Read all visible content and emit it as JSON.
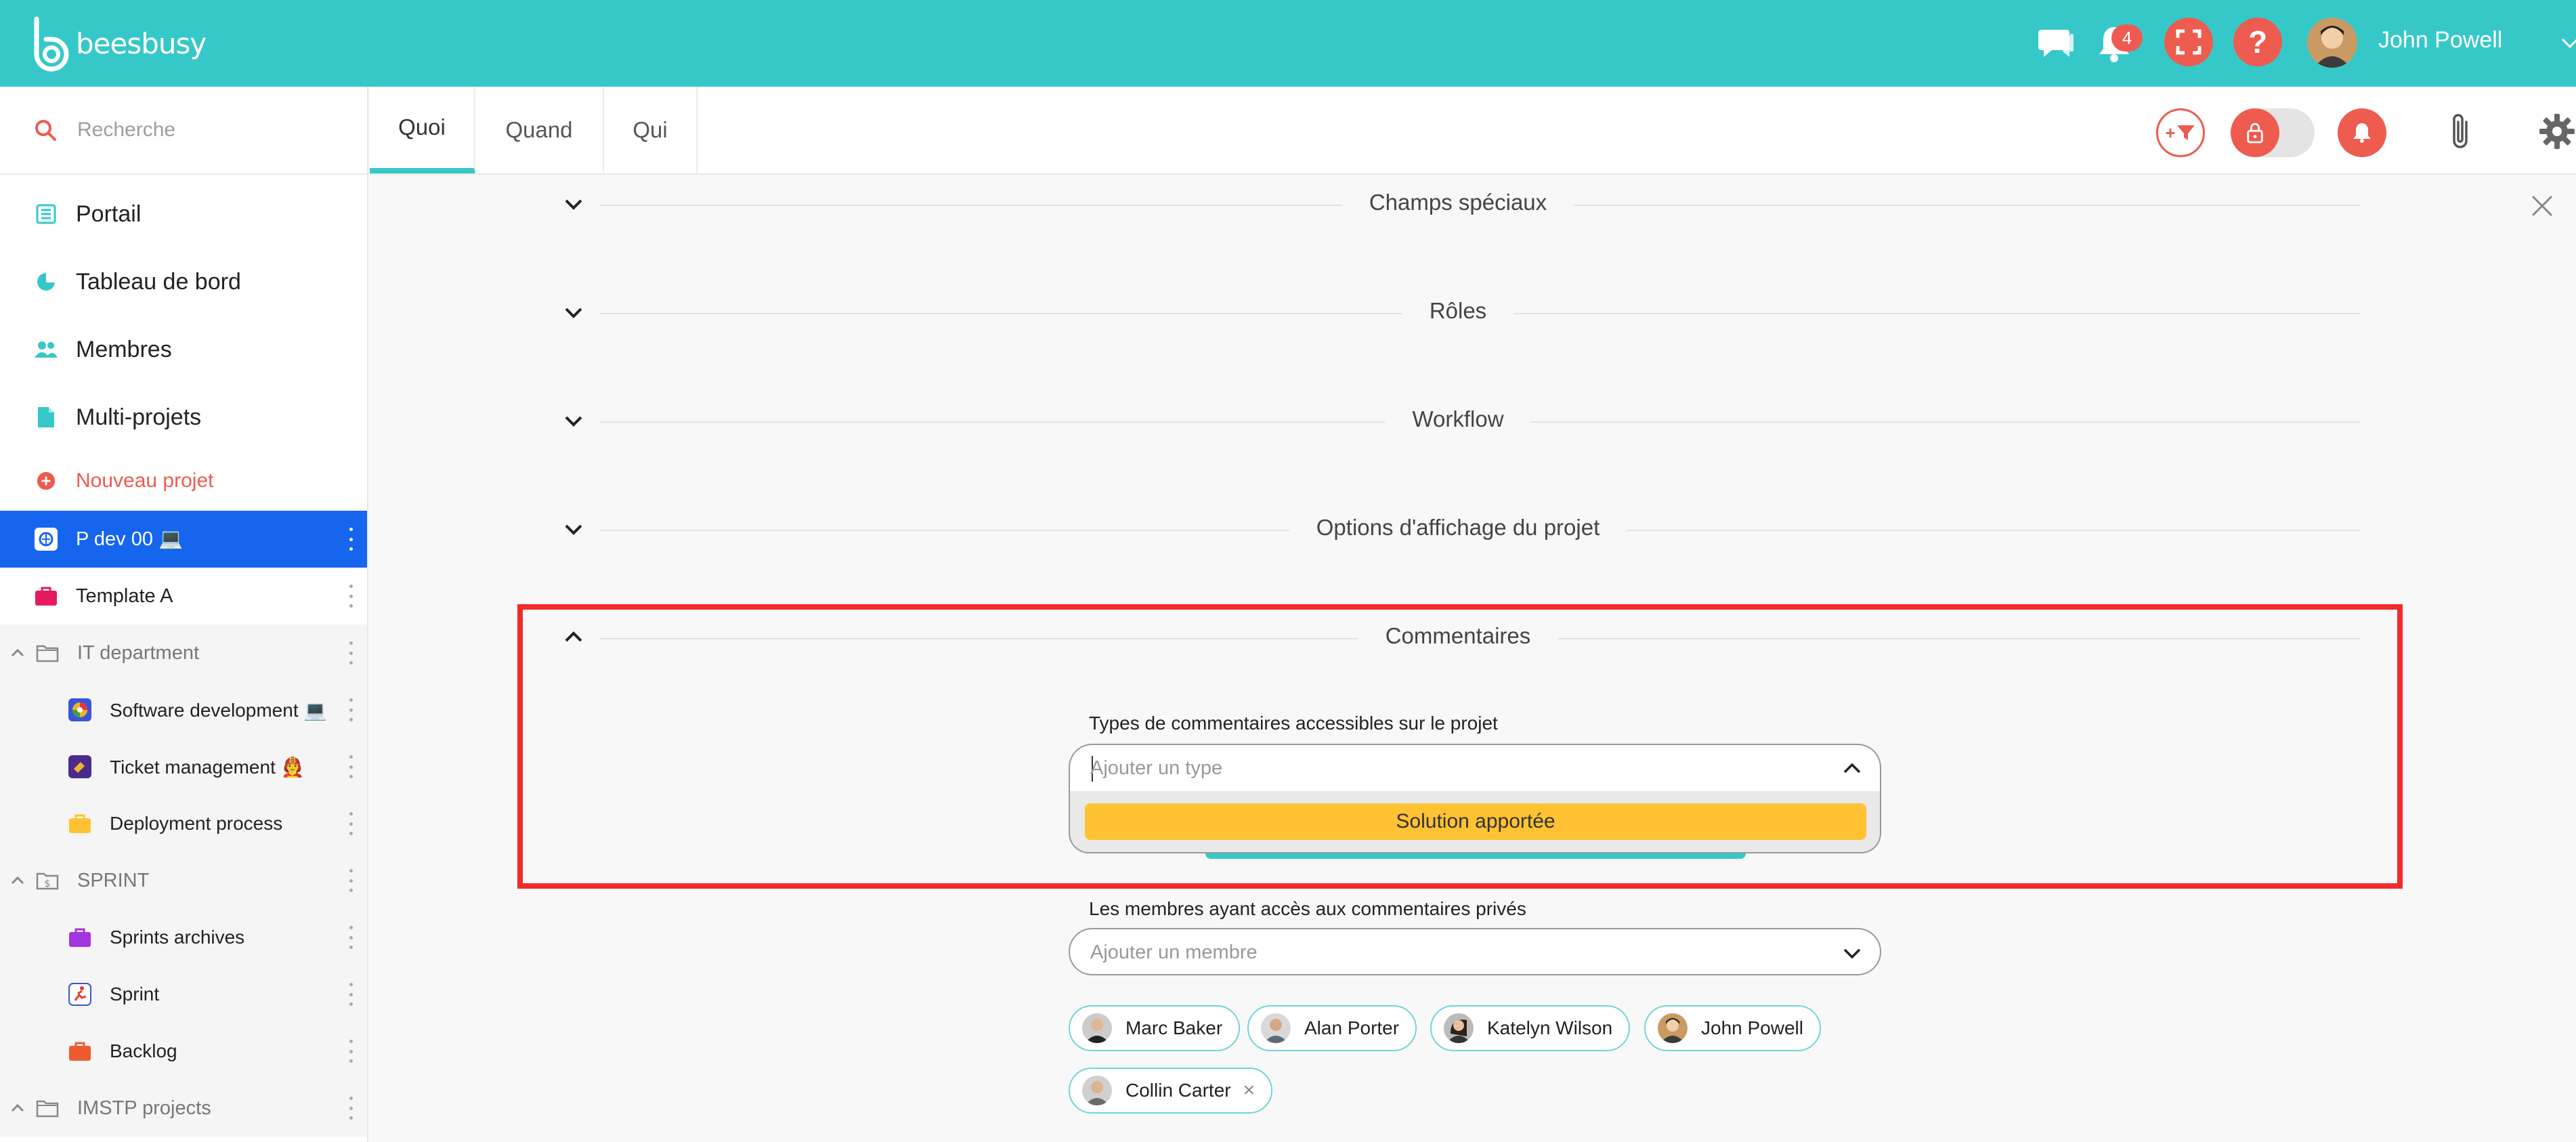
{
  "brand": {
    "logo_text": "beesbusy"
  },
  "topbar": {
    "notifications_count": "4",
    "help_label": "?",
    "user_name": "John Powell"
  },
  "sidebar": {
    "search_placeholder": "Recherche",
    "main_items": [
      {
        "label": "Portail",
        "icon": "list-icon"
      },
      {
        "label": "Tableau de bord",
        "icon": "pie-chart-icon"
      },
      {
        "label": "Membres",
        "icon": "people-icon"
      },
      {
        "label": "Multi-projets",
        "icon": "document-icon"
      }
    ],
    "new_project_label": "Nouveau projet",
    "projects": [
      {
        "label": "P dev 00 💻",
        "active": true
      },
      {
        "label": "Template A",
        "active": false
      }
    ],
    "folders": [
      {
        "label": "IT department",
        "items": [
          {
            "label": "Software development 💻"
          },
          {
            "label": "Ticket management 🧑‍🚒"
          },
          {
            "label": "Deployment process"
          }
        ]
      },
      {
        "label": "SPRINT",
        "items": [
          {
            "label": "Sprints archives"
          },
          {
            "label": "Sprint"
          },
          {
            "label": "Backlog"
          }
        ]
      },
      {
        "label": "IMSTP projects",
        "items": []
      }
    ]
  },
  "tabs": [
    {
      "label": "Quoi",
      "active": true
    },
    {
      "label": "Quand",
      "active": false
    },
    {
      "label": "Qui",
      "active": false
    }
  ],
  "toolbar": {
    "filter_label": "+"
  },
  "sections": [
    {
      "title": "Champs spéciaux",
      "expanded": false
    },
    {
      "title": "Rôles",
      "expanded": false
    },
    {
      "title": "Workflow",
      "expanded": false
    },
    {
      "title": "Options d'affichage du projet",
      "expanded": false
    },
    {
      "title": "Commentaires",
      "expanded": true
    }
  ],
  "comments": {
    "types_label": "Types de commentaires accessibles sur le projet",
    "types_placeholder": "Ajouter un type",
    "types_options": [
      "Solution apportée"
    ],
    "members_label": "Les membres ayant accès aux commentaires privés",
    "members_placeholder": "Ajouter un membre",
    "members": [
      {
        "name": "Marc Baker",
        "removable": false
      },
      {
        "name": "Alan Porter",
        "removable": false
      },
      {
        "name": "Katelyn Wilson",
        "removable": false
      },
      {
        "name": "John Powell",
        "removable": false
      },
      {
        "name": "Collin Carter",
        "removable": true,
        "remove_label": "×"
      }
    ]
  },
  "colors": {
    "brand": "#36c8c9",
    "accent_red": "#ee5b4f",
    "active_project": "#1565ef",
    "option_yellow": "#fec233",
    "highlight_red": "#f22b2b"
  }
}
